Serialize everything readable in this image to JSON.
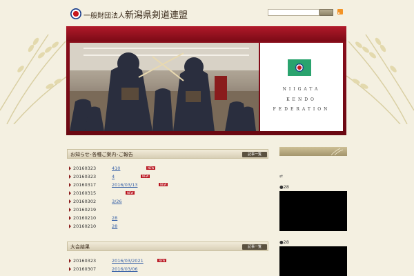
{
  "header": {
    "title_small": "一般財団法人",
    "title_big": "新潟県剣道連盟"
  },
  "hero": {
    "fed_lines": [
      "NIIGATA",
      "KENDO",
      "FEDERATION"
    ]
  },
  "sections": [
    {
      "title": "お知らせ･各種ご案内･ご報告",
      "button": "記事一覧",
      "rows": [
        {
          "date": "20160323",
          "link": "410",
          "new": "NEW"
        },
        {
          "date": "20160323",
          "link": "4",
          "new": "NEW"
        },
        {
          "date": "20160317",
          "link": "2016/03/13",
          "new": "NEW"
        },
        {
          "date": "20160315",
          "link": "",
          "new": "NEW"
        },
        {
          "date": "20160302",
          "link": "3/26",
          "new": ""
        },
        {
          "date": "20160219",
          "link": "",
          "new": ""
        },
        {
          "date": "20160210",
          "link": "28",
          "new": ""
        },
        {
          "date": "20160210",
          "link": "28",
          "new": ""
        }
      ]
    },
    {
      "title": "大会結果",
      "button": "記事一覧",
      "rows": [
        {
          "date": "20160323",
          "link": "2016/03/2021",
          "new": "NEW"
        },
        {
          "date": "20160307",
          "link": "2016/03/06",
          "new": ""
        }
      ]
    }
  ],
  "sidebar": {
    "arrow": "⇄",
    "label1": "●28",
    "label2": "●28"
  },
  "colors": {
    "hero_red": "#8e0e1c",
    "background": "#f4f0e1",
    "link": "#3a63a8",
    "new_badge": "#b8141e"
  }
}
